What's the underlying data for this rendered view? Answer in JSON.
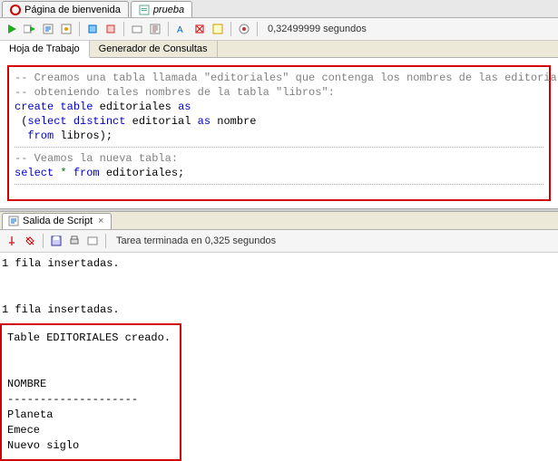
{
  "tabs": {
    "welcome": "Página de bienvenida",
    "prueba": "prueba"
  },
  "timing": "0,32499999 segundos",
  "subtabs": {
    "worksheet": "Hoja de Trabajo",
    "querygen": "Generador de Consultas"
  },
  "code": {
    "c1": "-- Creamos una tabla llamada \"editoriales\" que contenga los nombres de las editoriales",
    "c2": "-- obteniendo tales nombres de la tabla \"libros\":",
    "l1a": "create",
    "l1b": "table",
    "l1c": "editoriales",
    "l1d": "as",
    "l2a": " (",
    "l2b": "select",
    "l2c": "distinct",
    "l2d": "editorial",
    "l2e": "as",
    "l2f": "nombre",
    "l3a": "  ",
    "l3b": "from",
    "l3c": "libros);",
    "c3": "-- Veamos la nueva tabla:",
    "l4a": "select",
    "l4b": "*",
    "l4c": "from",
    "l4d": "editoriales;"
  },
  "output_tab": "Salida de Script",
  "task_msg": "Tarea terminada en 0,325 segundos",
  "out": {
    "ins1": "1 fila insertadas.",
    "ins2": "1 fila insertadas.",
    "created": "Table EDITORIALES creado.",
    "colhead": "NOMBRE",
    "dashes": "--------------------",
    "r1": "Planeta",
    "r2": "Emece",
    "r3": "Nuevo siglo"
  }
}
